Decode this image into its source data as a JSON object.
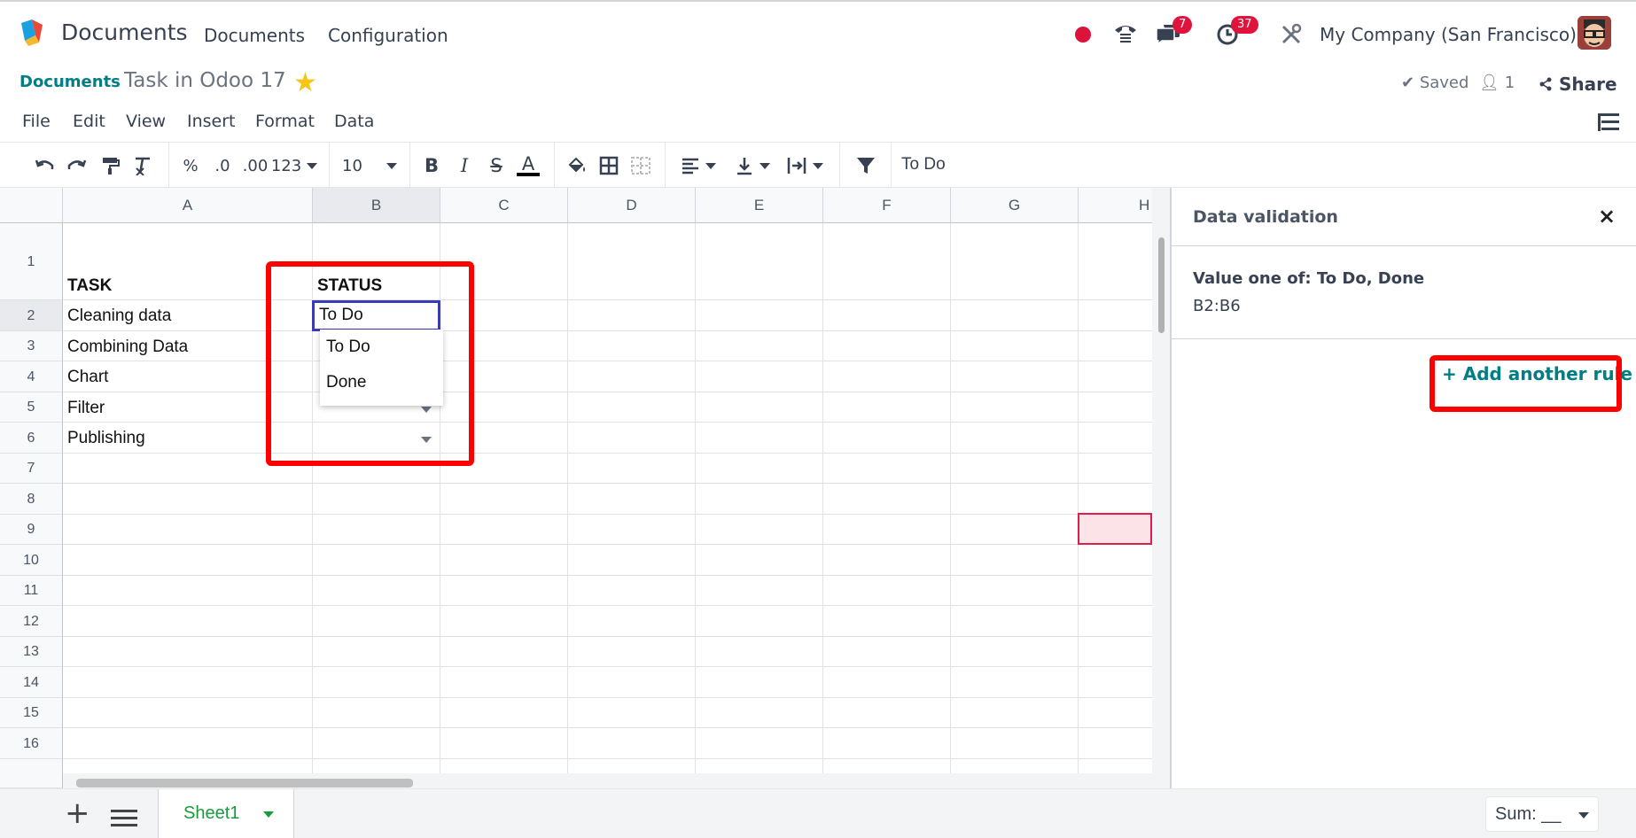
{
  "nav": {
    "app_title": "Documents",
    "menu": [
      "Documents",
      "Configuration"
    ],
    "chat_badge": "7",
    "activity_badge": "37",
    "company": "My Company (San Francisco)"
  },
  "breadcrumb": {
    "parent": "Documents",
    "document_name": "Task in Odoo 17",
    "saved_label": "Saved",
    "user_count": "1",
    "share_label": "Share"
  },
  "menubar": [
    "File",
    "Edit",
    "View",
    "Insert",
    "Format",
    "Data"
  ],
  "toolbar": {
    "percent": "%",
    "decrease_decimal": ".0",
    "increase_decimal": ".00",
    "more_formats": "123",
    "font_size": "10",
    "formula_value": "To Do"
  },
  "grid": {
    "columns": [
      "A",
      "B",
      "C",
      "D",
      "E",
      "F",
      "G",
      "H"
    ],
    "rows": [
      "1",
      "2",
      "3",
      "4",
      "5",
      "6",
      "7",
      "8",
      "9",
      "10",
      "11",
      "12",
      "13",
      "14",
      "15",
      "16"
    ],
    "selected_column": "B",
    "selected_row": "2",
    "header_task": "TASK",
    "header_status": "STATUS",
    "tasks": [
      "Cleaning data",
      "Combining Data",
      "Chart",
      "Filter",
      "Publishing"
    ],
    "active_cell_value": "To Do",
    "dropdown_options": [
      "To Do",
      "Done"
    ]
  },
  "side_panel": {
    "title": "Data validation",
    "close": "×",
    "rule_description": "Value one of: To Do, Done",
    "rule_range": "B2:B6",
    "add_rule": "+ Add another rule"
  },
  "bottom": {
    "add_sheet": "+",
    "sheet_name": "Sheet1",
    "sum_label": "Sum: __"
  },
  "colors": {
    "accent": "#017e84",
    "highlight": "#ff0000",
    "badge": "#e0133d",
    "sheet_tab": "#169c3c"
  }
}
